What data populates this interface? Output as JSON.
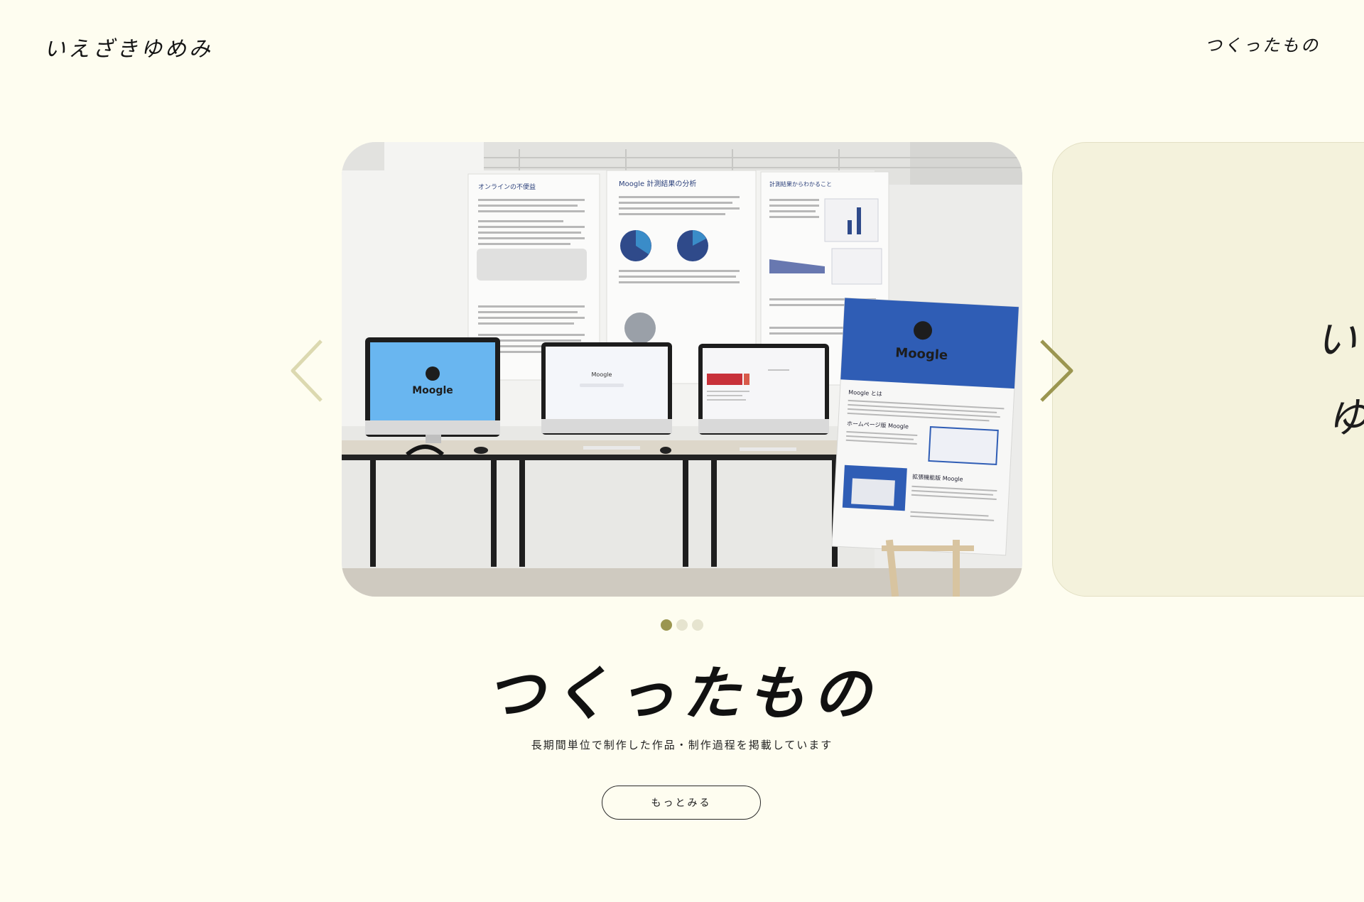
{
  "header": {
    "logo": "いえざきゆめみ",
    "nav_link": "つくったもの"
  },
  "carousel": {
    "slides": [
      {
        "type": "photo",
        "poster_titles": [
          "オンラインの不便益",
          "Moogle 計測結果の分析",
          "計測結果からわかること"
        ],
        "sign": {
          "brand": "Moogle",
          "headings": [
            "Moogle とは",
            "ホームページ版 Moogle",
            "拡張機能版 Moogle"
          ]
        },
        "monitors": [
          {
            "label": "Moogle"
          },
          {
            "label": "Moogle"
          },
          {
            "label": ""
          }
        ]
      },
      {
        "type": "text",
        "chars": [
          "い",
          "ゆ"
        ]
      }
    ],
    "active_index": 0,
    "dot_count": 3,
    "prev_icon": "chevron-left-icon",
    "next_icon": "chevron-right-icon"
  },
  "section": {
    "title": "つくったもの",
    "description": "長期間単位で制作した作品・制作過程を掲載しています",
    "button_label": "もっとみる"
  },
  "colors": {
    "background": "#fefdf0",
    "accent": "#9b9650",
    "dot_inactive": "#e6e4cf",
    "text": "#1b1b1b"
  }
}
